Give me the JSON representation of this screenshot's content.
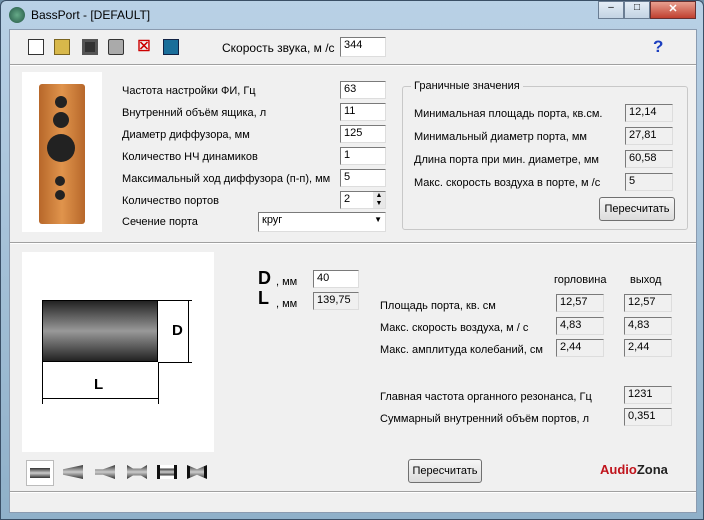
{
  "window": {
    "title": "BassPort - [DEFAULT]",
    "minimize": "–",
    "maximize": "□",
    "close": "✕"
  },
  "toolbar": {
    "icons": [
      "new-file-icon",
      "open-folder-icon",
      "save-icon",
      "print-icon",
      "delete-icon",
      "calculator-icon"
    ],
    "sound_speed_label": "Скорость звука, м /с",
    "sound_speed_value": "344",
    "help": "?"
  },
  "params": [
    {
      "label": "Частота настройки ФИ, Гц",
      "value": "63"
    },
    {
      "label": "Внутренний объём ящика, л",
      "value": "11"
    },
    {
      "label": "Диаметр диффузора, мм",
      "value": "125"
    },
    {
      "label": "Количество НЧ динамиков",
      "value": "1"
    },
    {
      "label": "Максимальный ход диффузора (п-п), мм",
      "value": "5"
    },
    {
      "label": "Количество портов",
      "value": "2"
    }
  ],
  "section": {
    "label": "Сечение порта",
    "value": "круг"
  },
  "limits": {
    "title": "Граничные значения",
    "rows": [
      {
        "label": "Минимальная площадь порта, кв.см.",
        "value": "12,14"
      },
      {
        "label": "Минимальный диаметр порта, мм",
        "value": "27,81"
      },
      {
        "label": "Длина порта при мин. диаметре, мм",
        "value": "60,58"
      },
      {
        "label": "Макс. скорость воздуха в порте, м /с",
        "value": "5"
      }
    ],
    "recalc": "Пересчитать"
  },
  "diagram": {
    "d": "D",
    "l": "L"
  },
  "dims": {
    "d_label": "D",
    "d_unit": ", мм",
    "d_value": "40",
    "l_label": "L",
    "l_unit": ", мм",
    "l_value": "139,75"
  },
  "results": {
    "col1": "горловина",
    "col2": "выход",
    "rows": [
      {
        "label": "Площадь порта, кв. см",
        "v1": "12,57",
        "v2": "12,57"
      },
      {
        "label": "Макс. скорость воздуха, м / с",
        "v1": "4,83",
        "v2": "4,83"
      },
      {
        "label": "Макс. амплитуда колебаний, см",
        "v1": "2,44",
        "v2": "2,44"
      }
    ],
    "resonance_label": "Главная частота органного резонанса, Гц",
    "resonance_value": "1231",
    "volume_label": "Суммарный внутренний объём портов, л",
    "volume_value": "0,351",
    "recalc": "Пересчитать"
  },
  "brand": {
    "a": "Audio",
    "b": "Zona",
    "color_a": "#c0141c",
    "color_b": "#222222"
  }
}
